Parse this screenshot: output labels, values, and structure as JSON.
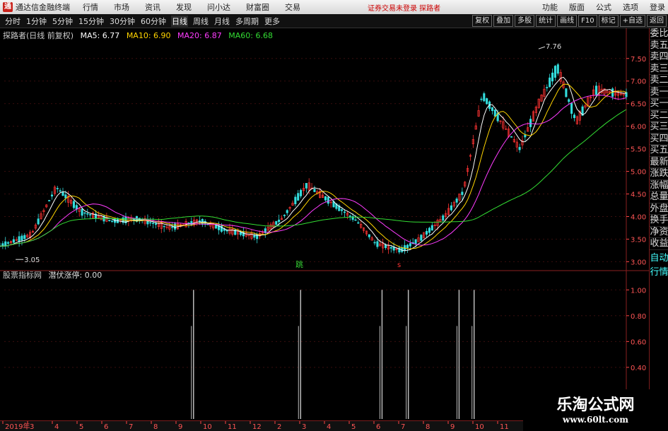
{
  "menubar": {
    "app_name": "通达信金融终端",
    "items": [
      "行情",
      "市场",
      "资讯",
      "发现",
      "问小达",
      "财富圈",
      "交易"
    ],
    "notice": "证券交易未登录  探路者",
    "right": [
      "功能",
      "版面",
      "公式",
      "选项",
      "登录"
    ]
  },
  "toolbar": {
    "timeframes": [
      "分时",
      "1分钟",
      "5分钟",
      "15分钟",
      "30分钟",
      "60分钟",
      "日线",
      "周线",
      "月线",
      "多周期",
      "更多"
    ],
    "active": "日线",
    "right_buttons": [
      "复权",
      "叠加",
      "多股",
      "统计",
      "画线",
      "F10",
      "标记",
      "+自选",
      "返回"
    ]
  },
  "main_info": {
    "title": "探路者(日线 前复权)",
    "ma": [
      {
        "label": "MA5: 6.77",
        "color": "#ffffff"
      },
      {
        "label": "MA10: 6.90",
        "color": "#ffd400"
      },
      {
        "label": "MA20: 6.87",
        "color": "#ff3cff"
      },
      {
        "label": "MA60: 6.68",
        "color": "#33dd33"
      }
    ]
  },
  "sub_info": {
    "title": "股票指标网",
    "indicator": "潜伏涨停: 0.00"
  },
  "price_axis": [
    "7.50",
    "7.00",
    "6.50",
    "6.00",
    "5.50",
    "5.00",
    "4.50",
    "4.00",
    "3.50",
    "3.00"
  ],
  "sub_axis": [
    "1.00",
    "0.80",
    "0.60",
    "0.40"
  ],
  "annotations": {
    "high": "7.76",
    "low": "3.05",
    "tag_green": "跳",
    "tag_red": "s"
  },
  "right_panel": [
    "委比",
    "卖五",
    "卖四",
    "卖三",
    "卖二",
    "卖一",
    "买一",
    "买二",
    "买三",
    "买四",
    "买五",
    "最新",
    "涨跌",
    "涨幅",
    "总量",
    "外盘",
    "换手",
    "净资",
    "收益"
  ],
  "right_panel2": [
    "自动",
    "行情"
  ],
  "date_axis": [
    "2019年",
    "3",
    "4",
    "5",
    "6",
    "7",
    "8",
    "9",
    "10",
    "11",
    "12",
    "2",
    "3",
    "4",
    "5",
    "6",
    "7",
    "8",
    "9",
    "10",
    "11"
  ],
  "watermark": {
    "title": "乐淘公式网",
    "url": "www.60lt.com"
  },
  "colors": {
    "up": "#ff3333",
    "down": "#33dddd",
    "axis": "#8a1f1f",
    "signal": "#bbbbbb"
  },
  "chart_data": [
    {
      "type": "line",
      "title": "探路者(日线 前复权)",
      "x": [
        0,
        0.05,
        0.09,
        0.13,
        0.18,
        0.22,
        0.27,
        0.32,
        0.36,
        0.41,
        0.45,
        0.49,
        0.53,
        0.57,
        0.6,
        0.64,
        0.67,
        0.71,
        0.74,
        0.77,
        0.8,
        0.83,
        0.86,
        0.89,
        0.92,
        0.95,
        1
      ],
      "series": [
        {
          "values": [
            3.35,
            3.6,
            4.65,
            4.1,
            3.9,
            3.95,
            3.75,
            3.9,
            3.7,
            3.55,
            3.95,
            4.7,
            4.3,
            3.9,
            3.4,
            3.25,
            3.5,
            4.0,
            4.55,
            6.7,
            6.1,
            5.5,
            6.5,
            7.3,
            6.1,
            6.8,
            6.7
          ]
        }
      ],
      "ylim": [
        2.85,
        7.95
      ]
    },
    {
      "type": "bar",
      "series": [
        {
          "name": "潜伏涨停",
          "values": [
            1,
            1,
            1,
            1,
            1,
            1
          ]
        }
      ],
      "x": [
        0.309,
        0.48,
        0.61,
        0.652,
        0.733,
        0.757
      ],
      "ylim": [
        0,
        1.1
      ]
    }
  ]
}
